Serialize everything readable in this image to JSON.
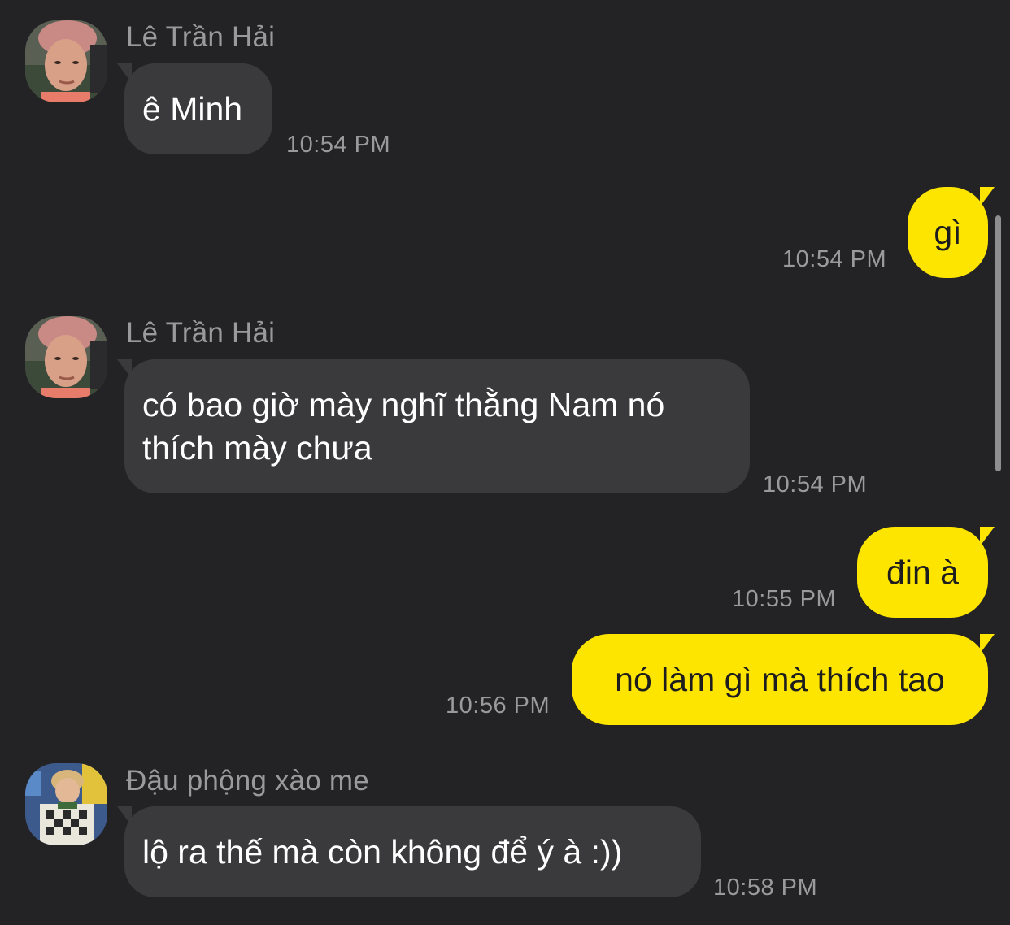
{
  "chat": {
    "messages": [
      {
        "sender": "Lê Trần Hải",
        "text": "ê Minh",
        "time": "10:54 PM",
        "direction": "incoming"
      },
      {
        "text": "gì",
        "time": "10:54 PM",
        "direction": "outgoing"
      },
      {
        "sender": "Lê Trần Hải",
        "text": "có bao giờ mày nghĩ thằng Nam nó\nthích mày chưa",
        "time": "10:54 PM",
        "direction": "incoming"
      },
      {
        "text": "đin à",
        "time": "10:55 PM",
        "direction": "outgoing"
      },
      {
        "text": "nó làm gì mà thích tao",
        "time": "10:56 PM",
        "direction": "outgoing"
      },
      {
        "sender": "Đậu phộng xào me",
        "text": "lộ ra thế mà còn không để ý à :))",
        "time": "10:58 PM",
        "direction": "incoming"
      }
    ]
  },
  "colors": {
    "background": "#232325",
    "incoming_bubble": "#3a3a3c",
    "outgoing_bubble": "#fee500",
    "meta_text": "#9a9a9d"
  }
}
